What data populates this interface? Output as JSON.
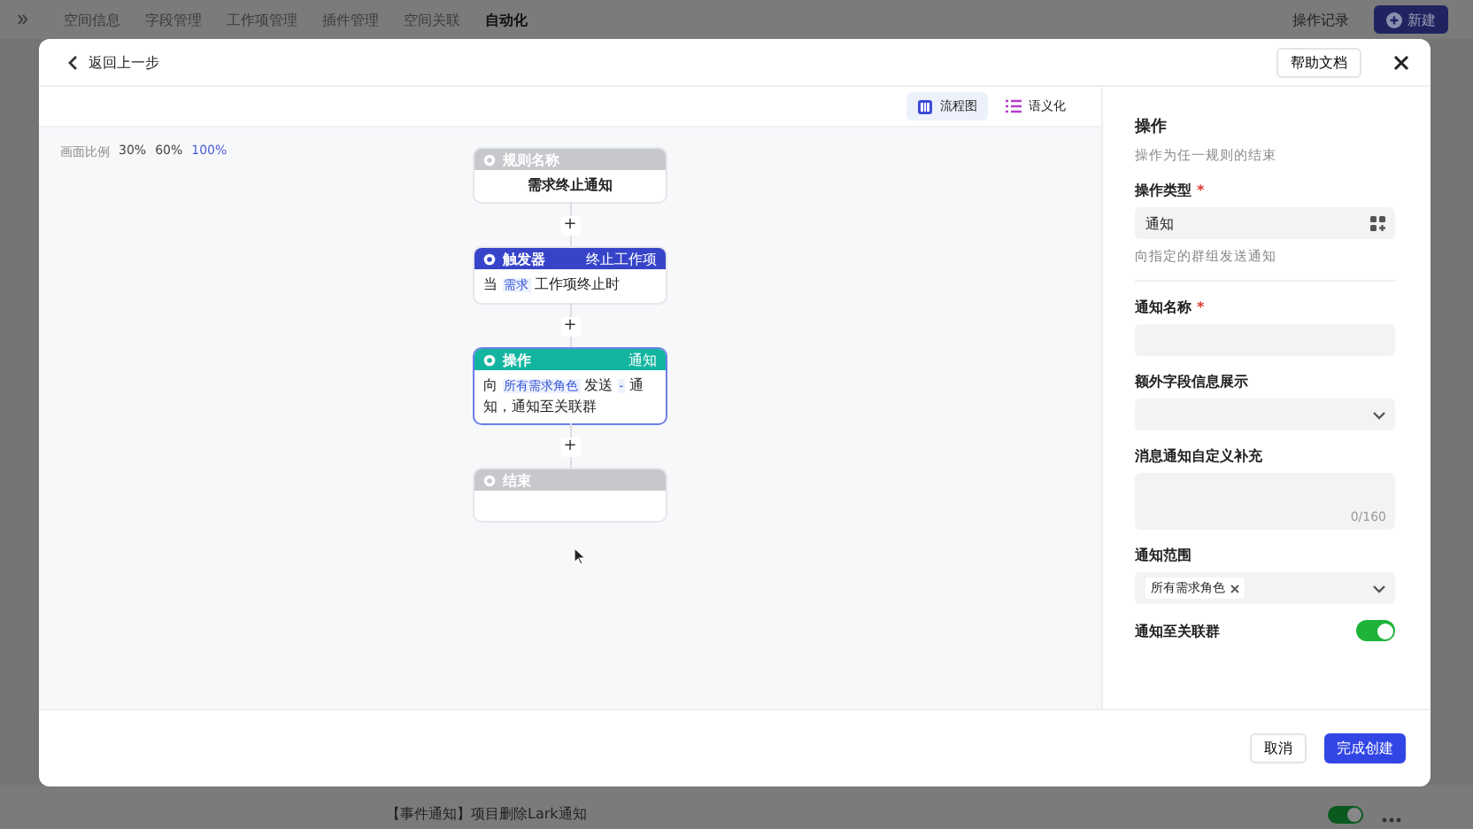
{
  "page": {
    "nav_tabs": [
      {
        "label": "空间信息",
        "selected": false
      },
      {
        "label": "字段管理",
        "selected": false
      },
      {
        "label": "工作项管理",
        "selected": false
      },
      {
        "label": "插件管理",
        "selected": false
      },
      {
        "label": "空间关联",
        "selected": false
      },
      {
        "label": "自动化",
        "selected": true
      }
    ],
    "history_link": "操作记录",
    "new_button": "新建",
    "rule_row": {
      "name": "【事件通知】项目删除Lark通知",
      "on": true
    }
  },
  "modal": {
    "back": "返回上一步",
    "help": "帮助文档",
    "views": [
      {
        "label": "流程图",
        "selected": true,
        "kind": "flow"
      },
      {
        "label": "语义化",
        "selected": false,
        "kind": "list"
      }
    ],
    "zoom_label": "画面比例",
    "zoom_options": [
      {
        "label": "30%",
        "selected": false
      },
      {
        "label": "60%",
        "selected": false
      },
      {
        "label": "100%",
        "selected": true
      }
    ],
    "nodes": [
      {
        "kind": "rule",
        "title": "规则名称",
        "body": [
          {
            "text": "需求终止通知",
            "kind": "text"
          }
        ]
      },
      {
        "kind": "trigger",
        "title": "触发器",
        "tag": "终止工作项",
        "body": [
          {
            "text": "当",
            "kind": "text"
          },
          {
            "text": "需求",
            "kind": "tag"
          },
          {
            "text": "工作项终止时",
            "kind": "text"
          }
        ]
      },
      {
        "kind": "action",
        "title": "操作",
        "tag": "通知",
        "selected": true,
        "body": [
          {
            "text": "向",
            "kind": "text"
          },
          {
            "text": "所有需求角色",
            "kind": "tag"
          },
          {
            "text": "发送",
            "kind": "text"
          },
          {
            "text": "-",
            "kind": "tag"
          },
          {
            "text": "通知，通知至关联群",
            "kind": "text"
          }
        ]
      },
      {
        "kind": "end",
        "title": "结束"
      }
    ],
    "add_step": "+",
    "panel": {
      "title": "操作",
      "subtitle": "操作为任一规则的结束",
      "fields": [
        {
          "kind": "select",
          "label": "操作类型",
          "required_mark": "*",
          "value": "通知",
          "hint": "向指定的群组发送通知"
        },
        {
          "kind": "input",
          "label": "通知名称",
          "required_mark": "*"
        },
        {
          "kind": "dropdown",
          "label": "额外字段信息展示"
        },
        {
          "kind": "textarea",
          "label": "消息通知自定义补充",
          "counter": "0/160"
        },
        {
          "kind": "tags",
          "label": "通知范围",
          "tags": [
            "所有需求角色"
          ]
        },
        {
          "kind": "switch",
          "label": "通知至关联群",
          "on": true
        }
      ]
    },
    "cancel": "取消",
    "submit": "完成创建"
  }
}
